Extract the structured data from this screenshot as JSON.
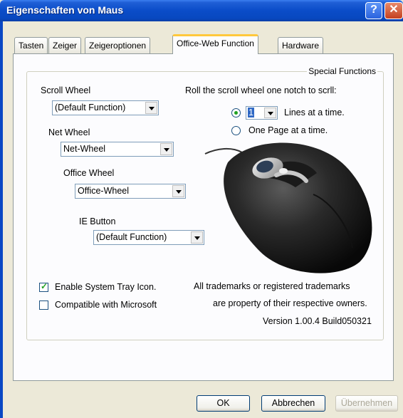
{
  "window": {
    "title": "Eigenschaften von Maus",
    "help_glyph": "?",
    "close_glyph": "✕"
  },
  "tabs": [
    {
      "label": "Tasten",
      "active": false
    },
    {
      "label": "Zeiger",
      "active": false
    },
    {
      "label": "Zeigeroptionen",
      "active": false
    },
    {
      "label": "Office-Web Function",
      "active": true
    },
    {
      "label": "Hardware",
      "active": false
    }
  ],
  "panel": {
    "group_title": "Special Functions",
    "scroll_wheel": {
      "label": "Scroll Wheel",
      "value": "(Default Function)"
    },
    "net_wheel": {
      "label": "Net Wheel",
      "value": "Net-Wheel"
    },
    "office_wheel": {
      "label": "Office Wheel",
      "value": "Office-Wheel"
    },
    "ie_button": {
      "label": "IE Button",
      "value": "(Default Function)"
    },
    "roll_label": "Roll the scroll wheel one notch to scrll:",
    "lines_option": {
      "value": "1",
      "label": "Lines at a time.",
      "checked": true
    },
    "page_option": {
      "label": "One Page at a time.",
      "checked": false
    },
    "system_tray": {
      "label": "Enable System Tray Icon.",
      "checked": true
    },
    "compatible": {
      "label": "Compatible with Microsoft",
      "checked": false
    },
    "trademark_line1": "All trademarks or registered trademarks",
    "trademark_line2": "are property of their respective owners.",
    "version": "Version 1.00.4 Build050321"
  },
  "buttons": {
    "ok": "OK",
    "cancel": "Abbrechen",
    "apply": "Übernehmen"
  },
  "colors": {
    "titlebar": "#0a4cc8",
    "tab_highlight": "#ffc83c",
    "selection": "#316ac5",
    "checkmark": "#21a121"
  }
}
